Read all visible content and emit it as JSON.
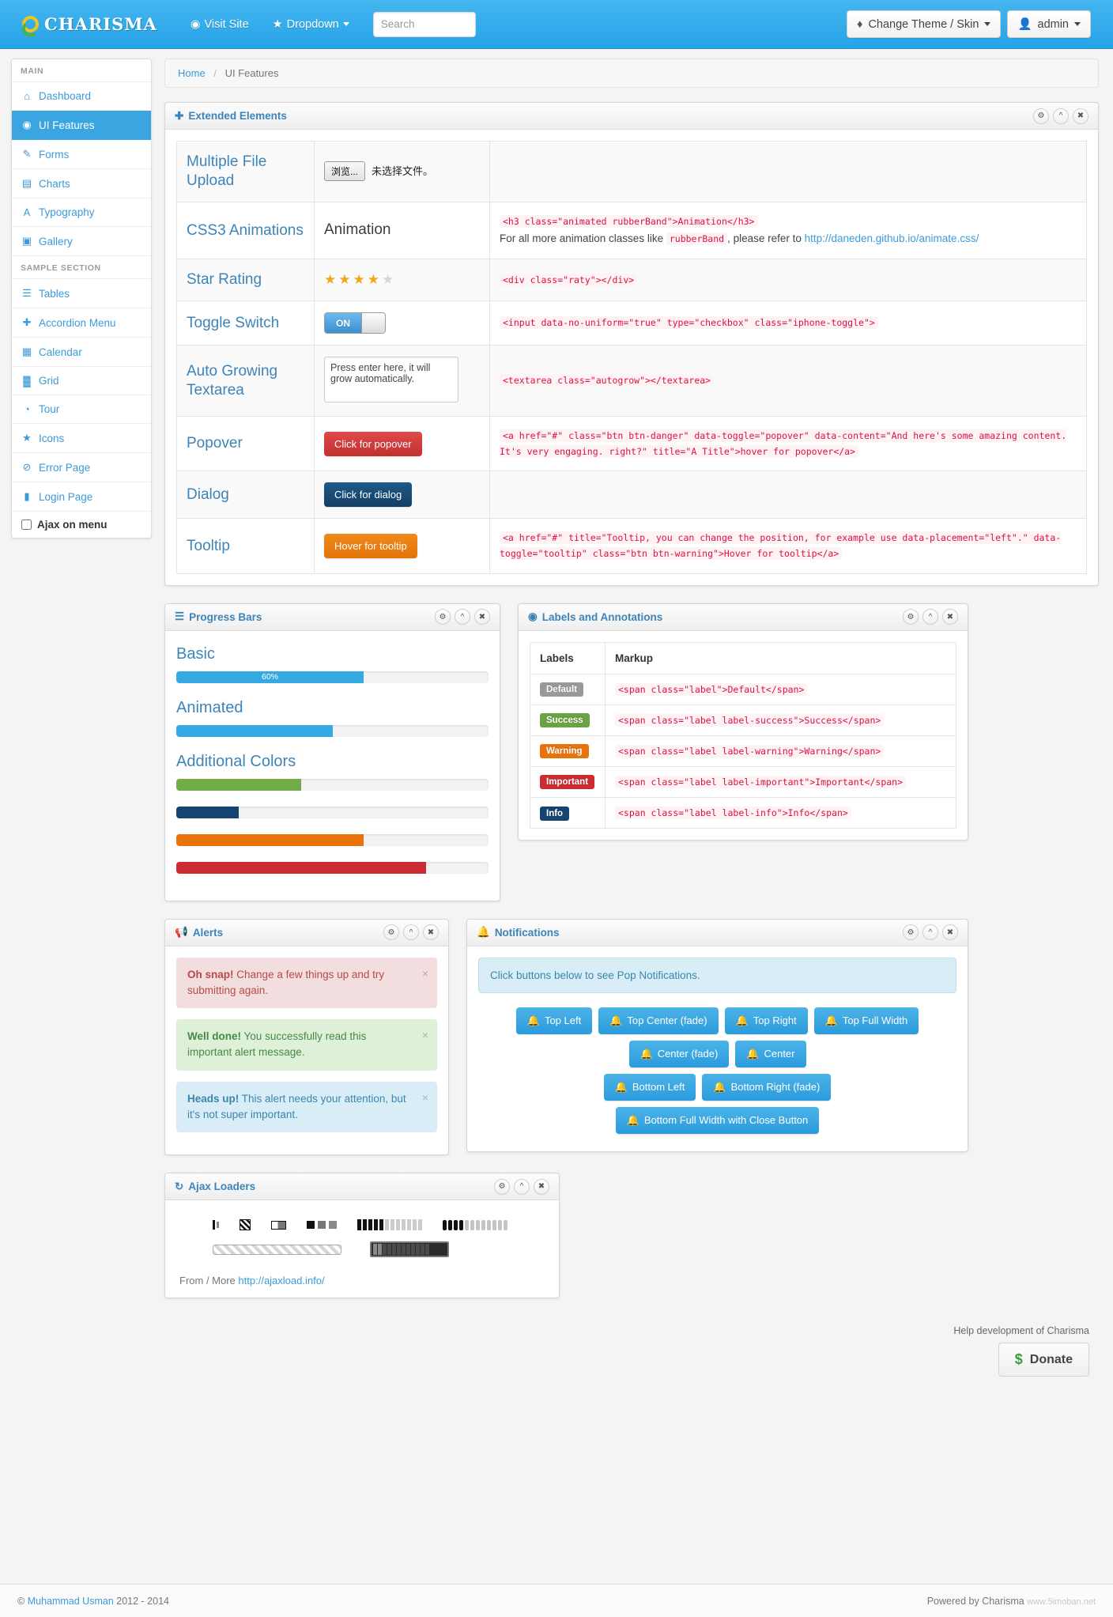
{
  "navbar": {
    "brand": "CHARISMA",
    "visit_site": "Visit Site",
    "dropdown": "Dropdown",
    "search_placeholder": "Search",
    "theme_button": "Change Theme / Skin",
    "user_button": "admin"
  },
  "sidebar": {
    "section_main": "MAIN",
    "section_sample": "SAMPLE SECTION",
    "main_items": [
      {
        "label": "Dashboard",
        "icon": "home-icon",
        "glyph": "⌂",
        "active": false
      },
      {
        "label": "UI Features",
        "icon": "eye-icon",
        "glyph": "◉",
        "active": true
      },
      {
        "label": "Forms",
        "icon": "edit-icon",
        "glyph": "✎",
        "active": false
      },
      {
        "label": "Charts",
        "icon": "chart-icon",
        "glyph": "▤",
        "active": false
      },
      {
        "label": "Typography",
        "icon": "font-icon",
        "glyph": "A",
        "active": false
      },
      {
        "label": "Gallery",
        "icon": "picture-icon",
        "glyph": "▣",
        "active": false
      }
    ],
    "sample_items": [
      {
        "label": "Tables",
        "icon": "list-icon",
        "glyph": "☰",
        "active": false
      },
      {
        "label": "Accordion Menu",
        "icon": "plus-icon",
        "glyph": "✚",
        "active": false
      },
      {
        "label": "Calendar",
        "icon": "calendar-icon",
        "glyph": "▦",
        "active": false
      },
      {
        "label": "Grid",
        "icon": "grid-icon",
        "glyph": "▓",
        "active": false
      },
      {
        "label": "Tour",
        "icon": "globe-icon",
        "glyph": "◔",
        "active": false
      },
      {
        "label": "Icons",
        "icon": "star-icon",
        "glyph": "★",
        "active": false
      },
      {
        "label": "Error Page",
        "icon": "ban-icon",
        "glyph": "⊘",
        "active": false
      },
      {
        "label": "Login Page",
        "icon": "lock-icon",
        "glyph": "▮",
        "active": false
      }
    ],
    "ajax_checkbox_label": "Ajax on menu",
    "ajax_checked": false
  },
  "breadcrumb": {
    "home": "Home",
    "current": "UI Features"
  },
  "extended": {
    "title": "Extended Elements",
    "rows": [
      {
        "label": "Multiple File Upload",
        "demo_type": "file",
        "file_button": "浏览...",
        "file_text": "未选择文件。",
        "code": "",
        "note": ""
      },
      {
        "label": "CSS3 Animations",
        "demo_type": "text",
        "demo_text": "Animation",
        "code": "<h3 class=\"animated rubberBand\">Animation</h3>",
        "note_pre": "For all more animation classes like",
        "note_code": "rubberBand",
        "note_mid": ", please refer to",
        "note_link": "http://daneden.github.io/animate.css/"
      },
      {
        "label": "Star Rating",
        "demo_type": "stars",
        "stars_filled": 4,
        "stars_total": 5,
        "code": "<div class=\"raty\"></div>"
      },
      {
        "label": "Toggle Switch",
        "demo_type": "toggle",
        "toggle_state": "ON",
        "code": "<input data-no-uniform=\"true\" type=\"checkbox\" class=\"iphone-toggle\">"
      },
      {
        "label": "Auto Growing Textarea",
        "demo_type": "textarea",
        "textarea_value": "Press enter here, it will grow automatically.",
        "code": "<textarea class=\"autogrow\"></textarea>"
      },
      {
        "label": "Popover",
        "demo_type": "button",
        "button_label": "Click for popover",
        "button_style": "btn-danger",
        "code": "<a href=\"#\" class=\"btn btn-danger\" data-toggle=\"popover\" data-content=\"And here's some amazing content. It's very engaging. right?\" title=\"A Title\">hover for popover</a>"
      },
      {
        "label": "Dialog",
        "demo_type": "button",
        "button_label": "Click for dialog",
        "button_style": "btn-dialog",
        "code": ""
      },
      {
        "label": "Tooltip",
        "demo_type": "button",
        "button_label": "Hover for tooltip",
        "button_style": "btn-warning",
        "code": "<a href=\"#\" title=\"Tooltip, you can change the position, for example use data-placement=\"left\".\" data-toggle=\"tooltip\" class=\"btn btn-warning\">Hover for tooltip</a>"
      }
    ]
  },
  "progress": {
    "title": "Progress Bars",
    "groups": [
      {
        "heading": "Basic",
        "bars": [
          {
            "percent": 60,
            "label": "60%",
            "color": "#35a9e3",
            "striped": false
          }
        ]
      },
      {
        "heading": "Animated",
        "bars": [
          {
            "percent": 50,
            "label": "",
            "color": "#35a9e3",
            "striped": true
          }
        ]
      },
      {
        "heading": "Additional Colors",
        "bars": [
          {
            "percent": 40,
            "label": "",
            "color": "#70ad47",
            "striped": true
          },
          {
            "percent": 20,
            "label": "",
            "color": "#14446f",
            "striped": true
          },
          {
            "percent": 60,
            "label": "",
            "color": "#e8730a",
            "striped": true
          },
          {
            "percent": 80,
            "label": "",
            "color": "#cc2b32",
            "striped": true
          }
        ]
      }
    ]
  },
  "labels": {
    "title": "Labels and Annotations",
    "col_labels": "Labels",
    "col_markup": "Markup",
    "rows": [
      {
        "badge": "Default",
        "color": "#999999",
        "markup": "<span class=\"label\">Default</span>"
      },
      {
        "badge": "Success",
        "color": "#6aa442",
        "markup": "<span class=\"label label-success\">Success</span>"
      },
      {
        "badge": "Warning",
        "color": "#e8730a",
        "markup": "<span class=\"label label-warning\">Warning</span>"
      },
      {
        "badge": "Important",
        "color": "#cc2b32",
        "markup": "<span class=\"label label-important\">Important</span>"
      },
      {
        "badge": "Info",
        "color": "#14446f",
        "markup": "<span class=\"label label-info\">Info</span>"
      }
    ]
  },
  "alerts": {
    "title": "Alerts",
    "items": [
      {
        "strong": "Oh snap!",
        "text": "Change a few things up and try submitting again.",
        "type": "alert-error"
      },
      {
        "strong": "Well done!",
        "text": "You successfully read this important alert message.",
        "type": "alert-success"
      },
      {
        "strong": "Heads up!",
        "text": "This alert needs your attention, but it's not super important.",
        "type": "alert-info"
      }
    ],
    "close_glyph": "×"
  },
  "notifications": {
    "title": "Notifications",
    "notice": "Click buttons below to see Pop Notifications.",
    "rows": [
      [
        "Top Left",
        "Top Center (fade)",
        "Top Right",
        "Top Full Width"
      ],
      [
        "Center (fade)",
        "Center"
      ],
      [
        "Bottom Left",
        "Bottom Right (fade)"
      ],
      [
        "Bottom Full Width with Close Button"
      ]
    ]
  },
  "ajax_loaders": {
    "title": "Ajax Loaders",
    "from_more": "From / More",
    "link": "http://ajaxload.info/"
  },
  "donate": {
    "label": "Help development of Charisma",
    "button": "Donate",
    "symbol": "$"
  },
  "footer": {
    "copyright_symbol": "©",
    "author": "Muhammad Usman",
    "years": "2012 - 2014",
    "powered": "Powered by Charisma",
    "watermark": "www.5imoban.net"
  },
  "icons": {
    "gear": "⚙",
    "chevron_up": "⌃",
    "close": "✖",
    "bell": "⚑",
    "plus": "✚",
    "eye": "◉",
    "megaphone": "◤",
    "refresh": "↻",
    "bars": "☰",
    "globe": "◔",
    "star": "★",
    "user": "♟",
    "drop": "◆"
  }
}
